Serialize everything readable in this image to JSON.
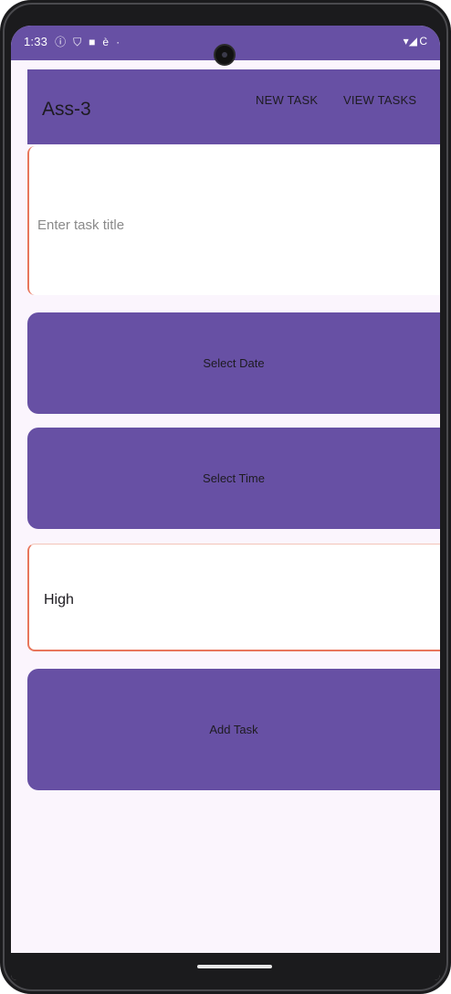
{
  "status_bar": {
    "time": "1:33",
    "left_icons": [
      "info-circle-icon",
      "shield-icon",
      "shield-icon",
      "accessibility-icon",
      "dot-icon"
    ],
    "right_icons": [
      "wifi-icon",
      "signal-icon",
      "battery-icon"
    ],
    "right_text": "▾◢ C"
  },
  "app_bar": {
    "title": "Ass-3",
    "actions": {
      "new_task": "NEW TASK",
      "view_tasks": "VIEW TASKS"
    }
  },
  "form": {
    "task_title_placeholder": "Enter task title",
    "task_title_value": "",
    "select_date_label": "Select Date",
    "select_time_label": "Select Time",
    "priority_value": "High",
    "add_task_label": "Add Task"
  },
  "colors": {
    "primary": "#6750a4",
    "background": "#fbf5fd",
    "field_accent": "#e8765c"
  }
}
